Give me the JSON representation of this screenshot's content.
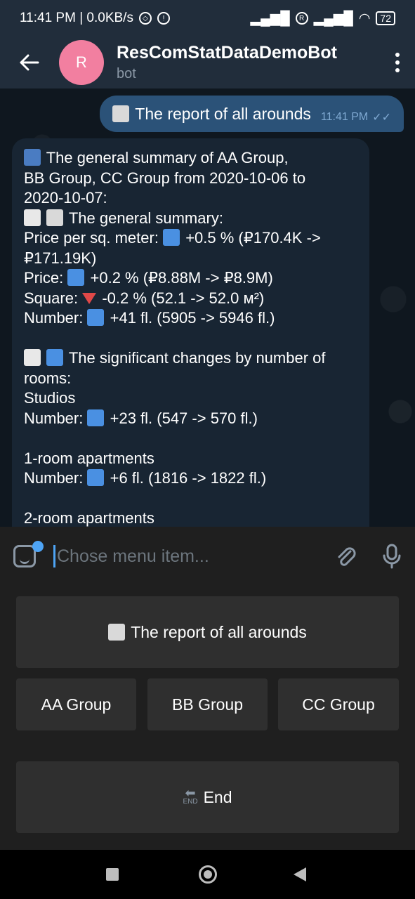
{
  "status_bar": {
    "time_speed": "11:41 PM | 0.0KB/s",
    "battery": "72"
  },
  "header": {
    "avatar_letter": "R",
    "title": "ResComStatDataDemoBot",
    "subtitle": "bot"
  },
  "chat": {
    "outgoing": {
      "text": "The report of all arounds",
      "time": "11:41 PM"
    },
    "incoming_lines": [
      "The general summary of AA Group,",
      "BB Group, CC Group from 2020-10-06 to",
      "2020-10-07:",
      "The general summary:",
      "Price per sq. meter:",
      "+0.5 % (₽170.4K ->",
      "₽171.19K)",
      "Price:",
      "+0.2 % (₽8.88M -> ₽8.9M)",
      "Square:",
      "-0.2 % (52.1 -> 52.0 м²)",
      "Number:",
      "+41 fl. (5905 -> 5946 fl.)",
      "",
      "The significant changes by number of",
      "rooms:",
      "Studios",
      "Number:",
      "+23 fl. (547 -> 570 fl.)",
      "",
      "1-room apartments",
      "Number:",
      "+6 fl. (1816 -> 1822 fl.)",
      "",
      "2-room apartments"
    ]
  },
  "input": {
    "placeholder": "Chose menu item..."
  },
  "keyboard": {
    "report": "The report of all arounds",
    "aa": "AA Group",
    "bb": "BB Group",
    "cc": "CC Group",
    "end": "End",
    "end_icon_text": "END"
  }
}
